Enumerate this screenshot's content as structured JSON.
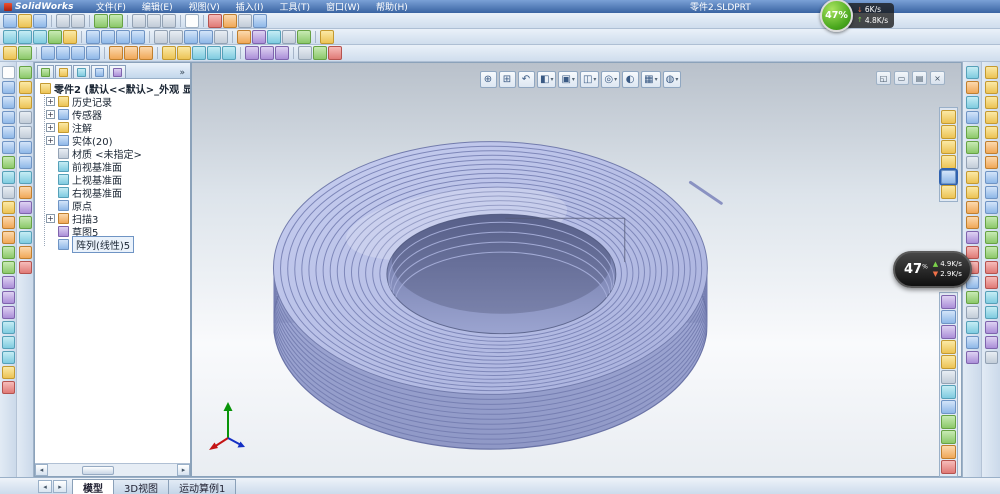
{
  "title_bar": {
    "app_name": "SolidWorks",
    "menus": [
      {
        "n": "menu-file",
        "label": "文件(F)"
      },
      {
        "n": "menu-edit",
        "label": "编辑(E)"
      },
      {
        "n": "menu-view",
        "label": "视图(V)"
      },
      {
        "n": "menu-insert",
        "label": "插入(I)"
      },
      {
        "n": "menu-tools",
        "label": "工具(T)"
      },
      {
        "n": "menu-window",
        "label": "窗口(W)"
      },
      {
        "n": "menu-help",
        "label": "帮助(H)"
      }
    ],
    "doc_title": "零件2.SLDPRT"
  },
  "overlay": {
    "green_badge": {
      "percent": "47%",
      "rows": [
        {
          "n": "download-speed",
          "arrow": "↓",
          "c": "arr-r",
          "value": "6K/s"
        },
        {
          "n": "upload-speed",
          "arrow": "↑",
          "c": "arr-g",
          "value": "4.8K/s"
        }
      ]
    },
    "dark_badge": {
      "percent": "47",
      "unit": "%",
      "rows": [
        {
          "n": "upload-speed",
          "arrow": "▲",
          "c": "arr-g",
          "value": "4.9K/s"
        },
        {
          "n": "download-speed",
          "arrow": "▼",
          "c": "arr-r",
          "value": "2.9K/s"
        }
      ]
    }
  },
  "toolbars": {
    "row1": [
      {
        "n": "new-icon",
        "c": "ic-b"
      },
      {
        "n": "open-icon",
        "c": "ic-y"
      },
      {
        "n": "save-icon",
        "c": "ic-b"
      },
      {
        "c": "tsep"
      },
      {
        "n": "print-icon",
        "c": "ic-k"
      },
      {
        "n": "print-preview-icon",
        "c": "ic-k"
      },
      {
        "c": "tsep"
      },
      {
        "n": "undo-icon",
        "c": "ic-g"
      },
      {
        "n": "redo-icon",
        "c": "ic-g"
      },
      {
        "c": "tsep"
      },
      {
        "n": "cut-icon",
        "c": "ic-k"
      },
      {
        "n": "copy-icon",
        "c": "ic-k"
      },
      {
        "n": "paste-icon",
        "c": "ic-k"
      },
      {
        "c": "tsep"
      },
      {
        "n": "select-icon",
        "c": "ic-w"
      },
      {
        "c": "tsep"
      },
      {
        "n": "rebuild-icon",
        "c": "ic-r"
      },
      {
        "n": "edit-color-icon",
        "c": "ic-o"
      },
      {
        "n": "options-icon",
        "c": "ic-k"
      },
      {
        "n": "help-icon",
        "c": "ic-b"
      }
    ],
    "row2": [
      {
        "n": "zoom-fit-icon",
        "c": "ic-c"
      },
      {
        "n": "zoom-area-icon",
        "c": "ic-c"
      },
      {
        "n": "zoom-in-out-icon",
        "c": "ic-c"
      },
      {
        "n": "rotate-view-icon",
        "c": "ic-g"
      },
      {
        "n": "pan-icon",
        "c": "ic-y"
      },
      {
        "c": "tsep"
      },
      {
        "n": "front-view-icon",
        "c": "ic-b"
      },
      {
        "n": "top-view-icon",
        "c": "ic-b"
      },
      {
        "n": "isometric-view-icon",
        "c": "ic-b"
      },
      {
        "n": "standard-views-icon",
        "c": "ic-b"
      },
      {
        "c": "tsep"
      },
      {
        "n": "wireframe-icon",
        "c": "ic-k"
      },
      {
        "n": "hidden-lines-visible-icon",
        "c": "ic-k"
      },
      {
        "n": "shaded-with-edges-icon",
        "c": "ic-b"
      },
      {
        "n": "shaded-icon",
        "c": "ic-b"
      },
      {
        "n": "shadows-icon",
        "c": "ic-k"
      },
      {
        "c": "tsep"
      },
      {
        "n": "section-view-icon",
        "c": "ic-o"
      },
      {
        "n": "camera-view-icon",
        "c": "ic-p"
      },
      {
        "n": "perspective-icon",
        "c": "ic-c"
      },
      {
        "n": "zebra-stripes-icon",
        "c": "ic-k"
      },
      {
        "n": "curvature-icon",
        "c": "ic-g"
      },
      {
        "c": "tsep"
      },
      {
        "n": "display-states-icon",
        "c": "ic-y"
      }
    ],
    "row3": [
      {
        "n": "sketch-icon",
        "c": "ic-y"
      },
      {
        "n": "smart-dimension-icon",
        "c": "ic-g"
      },
      {
        "c": "tsep"
      },
      {
        "n": "extruded-boss-icon",
        "c": "ic-b"
      },
      {
        "n": "revolved-boss-icon",
        "c": "ic-b"
      },
      {
        "n": "swept-boss-icon",
        "c": "ic-b"
      },
      {
        "n": "lofted-boss-icon",
        "c": "ic-b"
      },
      {
        "c": "tsep"
      },
      {
        "n": "extruded-cut-icon",
        "c": "ic-o"
      },
      {
        "n": "hole-wizard-icon",
        "c": "ic-o"
      },
      {
        "n": "revolved-cut-icon",
        "c": "ic-o"
      },
      {
        "c": "tsep"
      },
      {
        "n": "fillet-icon",
        "c": "ic-y"
      },
      {
        "n": "chamfer-icon",
        "c": "ic-y"
      },
      {
        "n": "shell-icon",
        "c": "ic-c"
      },
      {
        "n": "rib-icon",
        "c": "ic-c"
      },
      {
        "n": "draft-icon",
        "c": "ic-c"
      },
      {
        "c": "tsep"
      },
      {
        "n": "linear-pattern-icon",
        "c": "ic-p"
      },
      {
        "n": "circular-pattern-icon",
        "c": "ic-p"
      },
      {
        "n": "mirror-icon",
        "c": "ic-p"
      },
      {
        "c": "tsep"
      },
      {
        "n": "reference-geometry-icon",
        "c": "ic-k"
      },
      {
        "n": "curves-icon",
        "c": "ic-g"
      },
      {
        "n": "instant3d-icon",
        "c": "ic-r"
      }
    ],
    "left_col1": [
      {
        "n": "select-tool-icon",
        "c": "ic-w"
      },
      {
        "n": "line-icon",
        "c": "ic-b"
      },
      {
        "n": "centerline-icon",
        "c": "ic-b"
      },
      {
        "n": "rectangle-icon",
        "c": "ic-b"
      },
      {
        "n": "circle-icon",
        "c": "ic-b"
      },
      {
        "n": "arc-icon",
        "c": "ic-b"
      },
      {
        "n": "spline-icon",
        "c": "ic-g"
      },
      {
        "n": "ellipse-icon",
        "c": "ic-c"
      },
      {
        "n": "point-icon",
        "c": "ic-k"
      },
      {
        "n": "sketch-text-icon",
        "c": "ic-y"
      },
      {
        "n": "trim-entities-icon",
        "c": "ic-o"
      },
      {
        "n": "extend-entities-icon",
        "c": "ic-o"
      },
      {
        "n": "convert-entities-icon",
        "c": "ic-g"
      },
      {
        "n": "offset-entities-icon",
        "c": "ic-g"
      },
      {
        "n": "mirror-entities-icon",
        "c": "ic-p"
      },
      {
        "n": "linear-sketch-pattern-icon",
        "c": "ic-p"
      },
      {
        "n": "circular-sketch-pattern-icon",
        "c": "ic-p"
      },
      {
        "n": "move-entities-icon",
        "c": "ic-c"
      },
      {
        "n": "copy-entities-icon",
        "c": "ic-c"
      },
      {
        "n": "rotate-entities-icon",
        "c": "ic-c"
      },
      {
        "n": "scale-entities-icon",
        "c": "ic-y"
      },
      {
        "n": "add-relations-icon",
        "c": "ic-r"
      }
    ],
    "left_col2": [
      {
        "n": "dimension-icon",
        "c": "ic-g"
      },
      {
        "n": "note-icon",
        "c": "ic-y"
      },
      {
        "n": "balloon-icon",
        "c": "ic-y"
      },
      {
        "n": "surface-finish-icon",
        "c": "ic-k"
      },
      {
        "n": "weld-symbol-icon",
        "c": "ic-k"
      },
      {
        "n": "geometric-tolerance-icon",
        "c": "ic-b"
      },
      {
        "n": "datum-feature-icon",
        "c": "ic-b"
      },
      {
        "n": "center-mark-icon",
        "c": "ic-c"
      },
      {
        "n": "area-hatch-icon",
        "c": "ic-o"
      },
      {
        "n": "tables-icon",
        "c": "ic-p"
      },
      {
        "n": "block-icon",
        "c": "ic-g"
      },
      {
        "n": "measure-icon",
        "c": "ic-c"
      },
      {
        "n": "mass-properties-icon",
        "c": "ic-o"
      },
      {
        "n": "check-icon",
        "c": "ic-r"
      }
    ],
    "right_col1": [
      {
        "n": "measure-tool-icon",
        "c": "ic-c"
      },
      {
        "n": "mass-properties-tool-icon",
        "c": "ic-o"
      },
      {
        "n": "section-properties-icon",
        "c": "ic-c"
      },
      {
        "n": "sensor-tool-icon",
        "c": "ic-b"
      },
      {
        "n": "performance-evaluation-icon",
        "c": "ic-g"
      },
      {
        "n": "curvature-check-icon",
        "c": "ic-g"
      },
      {
        "n": "zebra-check-icon",
        "c": "ic-k"
      },
      {
        "n": "deviation-analysis-icon",
        "c": "ic-y"
      },
      {
        "n": "thickness-analysis-icon",
        "c": "ic-y"
      },
      {
        "n": "undercut-analysis-icon",
        "c": "ic-o"
      },
      {
        "n": "draft-analysis-icon",
        "c": "ic-o"
      },
      {
        "n": "symmetry-check-icon",
        "c": "ic-p"
      },
      {
        "n": "interference-detection-icon",
        "c": "ic-r"
      },
      {
        "n": "clearance-verification-icon",
        "c": "ic-r"
      },
      {
        "n": "hole-alignment-icon",
        "c": "ic-b"
      },
      {
        "n": "import-diagnostics-icon",
        "c": "ic-g"
      },
      {
        "n": "equations-icon",
        "c": "ic-k"
      },
      {
        "n": "statistics-icon",
        "c": "ic-c"
      },
      {
        "n": "check-entity-icon",
        "c": "ic-b"
      },
      {
        "n": "compare-icon",
        "c": "ic-p"
      }
    ],
    "right_col2": [
      {
        "n": "extruded-surface-icon",
        "c": "ic-y"
      },
      {
        "n": "revolved-surface-icon",
        "c": "ic-y"
      },
      {
        "n": "swept-surface-icon",
        "c": "ic-y"
      },
      {
        "n": "lofted-surface-icon",
        "c": "ic-y"
      },
      {
        "n": "boundary-surface-icon",
        "c": "ic-y"
      },
      {
        "n": "filled-surface-icon",
        "c": "ic-o"
      },
      {
        "n": "planar-surface-icon",
        "c": "ic-o"
      },
      {
        "n": "offset-surface-icon",
        "c": "ic-b"
      },
      {
        "n": "knit-surface-icon",
        "c": "ic-b"
      },
      {
        "n": "thicken-icon",
        "c": "ic-b"
      },
      {
        "n": "trim-surface-icon",
        "c": "ic-g"
      },
      {
        "n": "untrim-surface-icon",
        "c": "ic-g"
      },
      {
        "n": "extend-surface-icon",
        "c": "ic-g"
      },
      {
        "n": "delete-face-icon",
        "c": "ic-r"
      },
      {
        "n": "replace-face-icon",
        "c": "ic-r"
      },
      {
        "n": "ruled-surface-icon",
        "c": "ic-c"
      },
      {
        "n": "surface-flatten-icon",
        "c": "ic-c"
      },
      {
        "n": "midsurface-icon",
        "c": "ic-p"
      },
      {
        "n": "parting-surface-icon",
        "c": "ic-p"
      },
      {
        "n": "freeform-icon",
        "c": "ic-k"
      }
    ],
    "ref_geometry_group": [
      {
        "n": "ref-plane-icon",
        "c": "ic-y"
      },
      {
        "n": "ref-axis-icon",
        "c": "ic-y"
      },
      {
        "n": "coordinate-system-icon",
        "c": "ic-y"
      },
      {
        "n": "ref-point-icon",
        "c": "ic-y"
      },
      {
        "n": "center-of-mass-icon",
        "c": "ic-b hl"
      },
      {
        "n": "mate-reference-icon",
        "c": "ic-y"
      }
    ],
    "render_group": [
      {
        "n": "edit-appearance-tool-icon",
        "c": "ic-p"
      },
      {
        "n": "material-icon",
        "c": "ic-b"
      },
      {
        "n": "apply-scene-tool-icon",
        "c": "ic-p"
      },
      {
        "n": "decal-icon",
        "c": "ic-y"
      },
      {
        "n": "lighting-icon",
        "c": "ic-y"
      },
      {
        "n": "camera-icon",
        "c": "ic-k"
      },
      {
        "n": "walkthrough-icon",
        "c": "ic-c"
      },
      {
        "n": "display-state-icon",
        "c": "ic-b"
      },
      {
        "n": "render-icon",
        "c": "ic-g"
      },
      {
        "n": "render-region-icon",
        "c": "ic-g"
      },
      {
        "n": "motion-icon",
        "c": "ic-o"
      },
      {
        "n": "animation-icon",
        "c": "ic-r"
      }
    ]
  },
  "feature_panel": {
    "tabs": [
      {
        "n": "featuremanager-tab",
        "c": "ic-g"
      },
      {
        "n": "propertymanager-tab",
        "c": "ic-y"
      },
      {
        "n": "configurationmanager-tab",
        "c": "ic-c"
      },
      {
        "n": "dimxpertmanager-tab",
        "c": "ic-b"
      },
      {
        "n": "displaymanager-tab",
        "c": "ic-p"
      }
    ],
    "chevron": "»",
    "root_label": "零件2 (默认<<默认>_外观 显示",
    "items": [
      {
        "n": "tree-item-history",
        "expand": "+",
        "c": "ic-y",
        "label": "历史记录"
      },
      {
        "n": "tree-item-sensors",
        "expand": "+",
        "c": "ic-b",
        "label": "传感器"
      },
      {
        "n": "tree-item-annotations",
        "expand": "+",
        "c": "ic-y",
        "label": "注解"
      },
      {
        "n": "tree-item-solid-bodies",
        "expand": "+",
        "c": "ic-b",
        "label": "实体(20)"
      },
      {
        "n": "tree-item-material",
        "expand": "",
        "c": "ic-k",
        "label": "材质 <未指定>"
      },
      {
        "n": "tree-item-front-plane",
        "expand": "",
        "c": "ic-c",
        "label": "前视基准面"
      },
      {
        "n": "tree-item-top-plane",
        "expand": "",
        "c": "ic-c",
        "label": "上视基准面"
      },
      {
        "n": "tree-item-right-plane",
        "expand": "",
        "c": "ic-c",
        "label": "右视基准面"
      },
      {
        "n": "tree-item-origin",
        "expand": "",
        "c": "ic-b",
        "label": "原点"
      },
      {
        "n": "tree-item-sweep3",
        "expand": "+",
        "c": "ic-o",
        "label": "扫描3"
      },
      {
        "n": "tree-item-sketch5",
        "expand": "",
        "c": "ic-p",
        "label": "草图5"
      },
      {
        "n": "tree-item-linear-pattern5",
        "expand": "",
        "c": "ic-b",
        "label": "阵列(线性)5",
        "cls": "sel"
      }
    ]
  },
  "viewport_toolbar": [
    {
      "n": "zoom-fit-icon",
      "g": "⊕"
    },
    {
      "n": "zoom-area-icon",
      "g": "⊞"
    },
    {
      "n": "previous-view-icon",
      "g": "↶"
    },
    {
      "n": "section-view-icon",
      "g": "◧",
      "cr": "▾"
    },
    {
      "n": "view-orientation-icon",
      "g": "▣",
      "cr": "▾"
    },
    {
      "n": "display-style-icon",
      "g": "◫",
      "cr": "▾"
    },
    {
      "n": "hide-show-items-icon",
      "g": "◎",
      "cr": "▾"
    },
    {
      "n": "edit-appearance-icon",
      "g": "◐"
    },
    {
      "n": "apply-scene-icon",
      "g": "▦",
      "cr": "▾"
    },
    {
      "n": "view-settings-icon",
      "g": "◍",
      "cr": "▾"
    }
  ],
  "viewport_window_icons": [
    {
      "n": "window-restore-icon",
      "g": "◱"
    },
    {
      "n": "window-minimize-icon",
      "g": "▭"
    },
    {
      "n": "window-tile-icon",
      "g": "▤"
    },
    {
      "n": "window-close-icon",
      "g": "×"
    }
  ],
  "bottom_bar": {
    "nav": [
      {
        "n": "tab-scroll-left",
        "g": "◂"
      },
      {
        "n": "tab-scroll-right",
        "g": "▸"
      }
    ],
    "tabs": [
      {
        "n": "tab-model",
        "label": "模型",
        "cls": "active"
      },
      {
        "n": "tab-3d-views",
        "label": "3D视图"
      },
      {
        "n": "tab-motion-study-1",
        "label": "运动算例1"
      }
    ]
  }
}
